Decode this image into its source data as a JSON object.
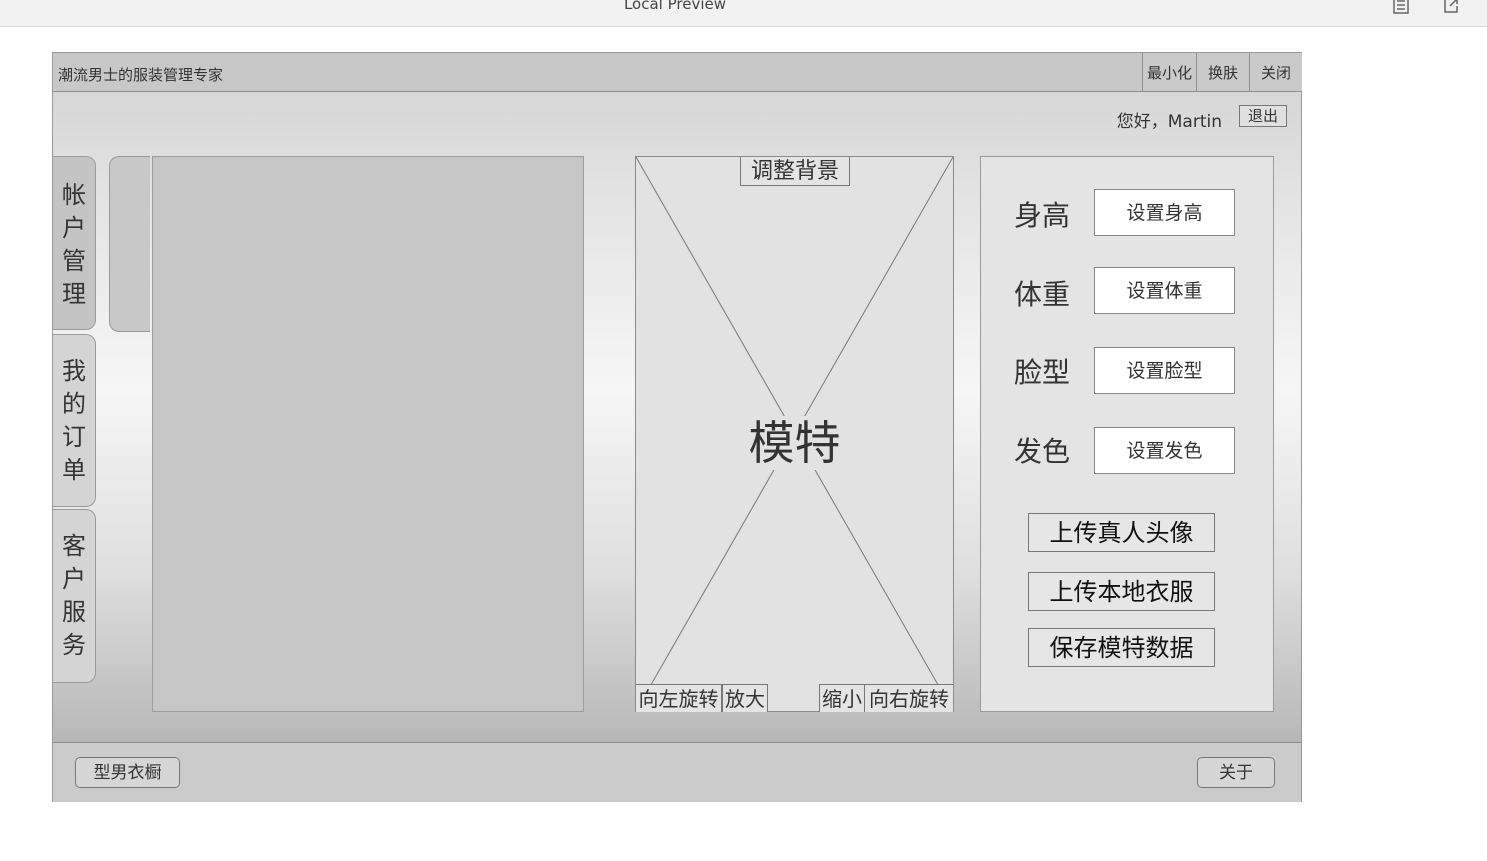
{
  "preview": {
    "title": "Local Preview"
  },
  "window": {
    "title": "潮流男士的服装管理专家",
    "buttons": {
      "minimize": "最小化",
      "skin": "换肤",
      "close": "关闭"
    }
  },
  "header": {
    "greeting": "您好，Martin",
    "logout": "退出"
  },
  "sidebar": {
    "tabs": [
      {
        "chars": [
          "帐",
          "户",
          "管",
          "理"
        ]
      },
      {
        "chars": [
          "我",
          "的",
          "订",
          "单"
        ]
      },
      {
        "chars": [
          "客",
          "户",
          "服",
          "务"
        ]
      }
    ]
  },
  "model": {
    "adjust_background": "调整背景",
    "label": "模特",
    "controls": {
      "rotate_left": "向左旋转",
      "zoom_in": "放大",
      "zoom_out": "缩小",
      "rotate_right": "向右旋转"
    }
  },
  "properties": {
    "height": {
      "label": "身高",
      "button": "设置身高"
    },
    "weight": {
      "label": "体重",
      "button": "设置体重"
    },
    "face": {
      "label": "脸型",
      "button": "设置脸型"
    },
    "hair": {
      "label": "发色",
      "button": "设置发色"
    },
    "actions": {
      "upload_avatar": "上传真人头像",
      "upload_clothes": "上传本地衣服",
      "save_model": "保存模特数据"
    }
  },
  "footer": {
    "wardrobe": "型男衣橱",
    "about": "关于"
  },
  "icons": [
    "document-icon",
    "export-icon"
  ]
}
